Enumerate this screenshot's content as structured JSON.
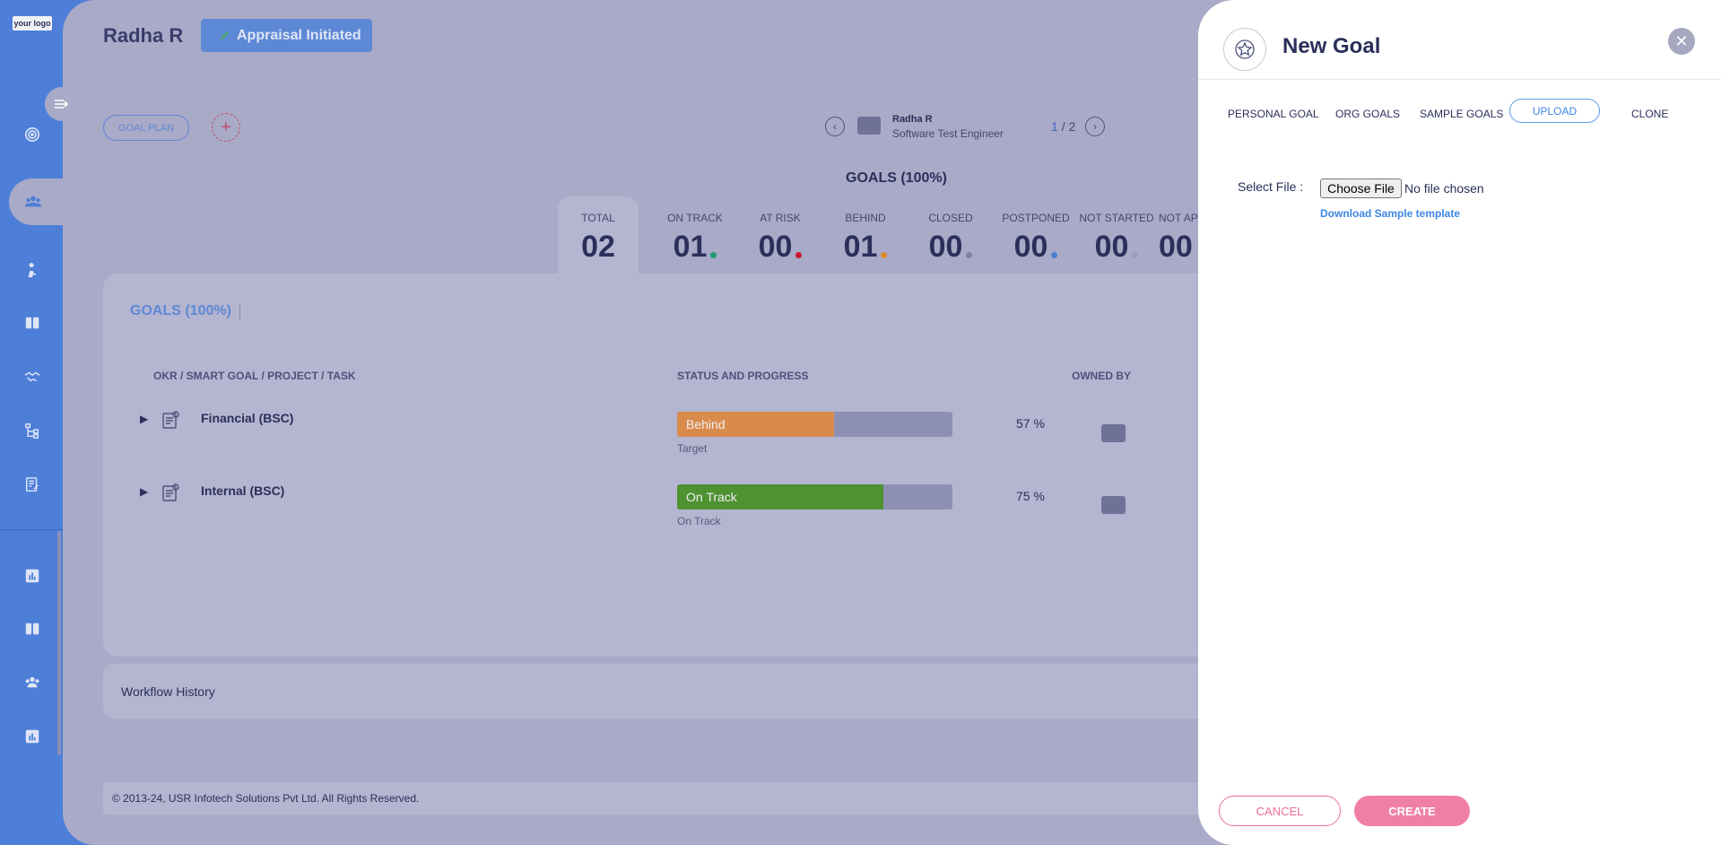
{
  "sidebar": {
    "logo_text": "your logo"
  },
  "header": {
    "employee_name": "Radha R",
    "status_label": "Appraisal Initiated"
  },
  "toolbar": {
    "goal_plan_label": "GOAL PLAN",
    "add_symbol": "+"
  },
  "employee_nav": {
    "name": "Radha R",
    "designation": "Software Test Engineer",
    "current_page": "1",
    "separator": "/",
    "total_pages": "2"
  },
  "goals_heading": "GOALS (100%)",
  "stats": [
    {
      "label": "TOTAL",
      "value": "02",
      "color": ""
    },
    {
      "label": "ON TRACK",
      "value": "01",
      "color": "#1f9a6e"
    },
    {
      "label": "AT RISK",
      "value": "00",
      "color": "#c8192e"
    },
    {
      "label": "BEHIND",
      "value": "01",
      "color": "#d98b2b"
    },
    {
      "label": "CLOSED",
      "value": "00",
      "color": "#7f819f"
    },
    {
      "label": "POSTPONED",
      "value": "00",
      "color": "#4a7fd0"
    },
    {
      "label": "NOT STARTED",
      "value": "00",
      "color": "#9d9fba"
    },
    {
      "label": "NOT API",
      "value": "00",
      "color": ""
    }
  ],
  "goals_card": {
    "title": "GOALS (100%)",
    "columns": [
      "OKR / SMART GOAL / PROJECT / TASK",
      "STATUS AND PROGRESS",
      "OWNED BY"
    ],
    "rows": [
      {
        "name": "Financial (BSC)",
        "status": "Behind",
        "sub_status": "Target",
        "progress": 57,
        "progress_text": "57  %",
        "color": "#d98b4b"
      },
      {
        "name": "Internal (BSC)",
        "status": "On Track",
        "sub_status": "On Track",
        "progress": 75,
        "progress_text": "75  %",
        "color": "#4e9232"
      }
    ]
  },
  "workflow_label": "Workflow History",
  "footer_text": "© 2013-24, USR Infotech Solutions Pvt Ltd. All Rights Reserved.",
  "panel": {
    "title": "New Goal",
    "tabs": [
      "PERSONAL GOAL",
      "ORG GOALS",
      "SAMPLE GOALS",
      "UPLOAD",
      "CLONE"
    ],
    "active_tab": "UPLOAD",
    "select_file_label": "Select File :",
    "choose_file_label": "Choose File",
    "file_status": "No file chosen",
    "sample_template_link": "Download Sample template",
    "cancel_label": "CANCEL",
    "create_label": "CREATE"
  }
}
